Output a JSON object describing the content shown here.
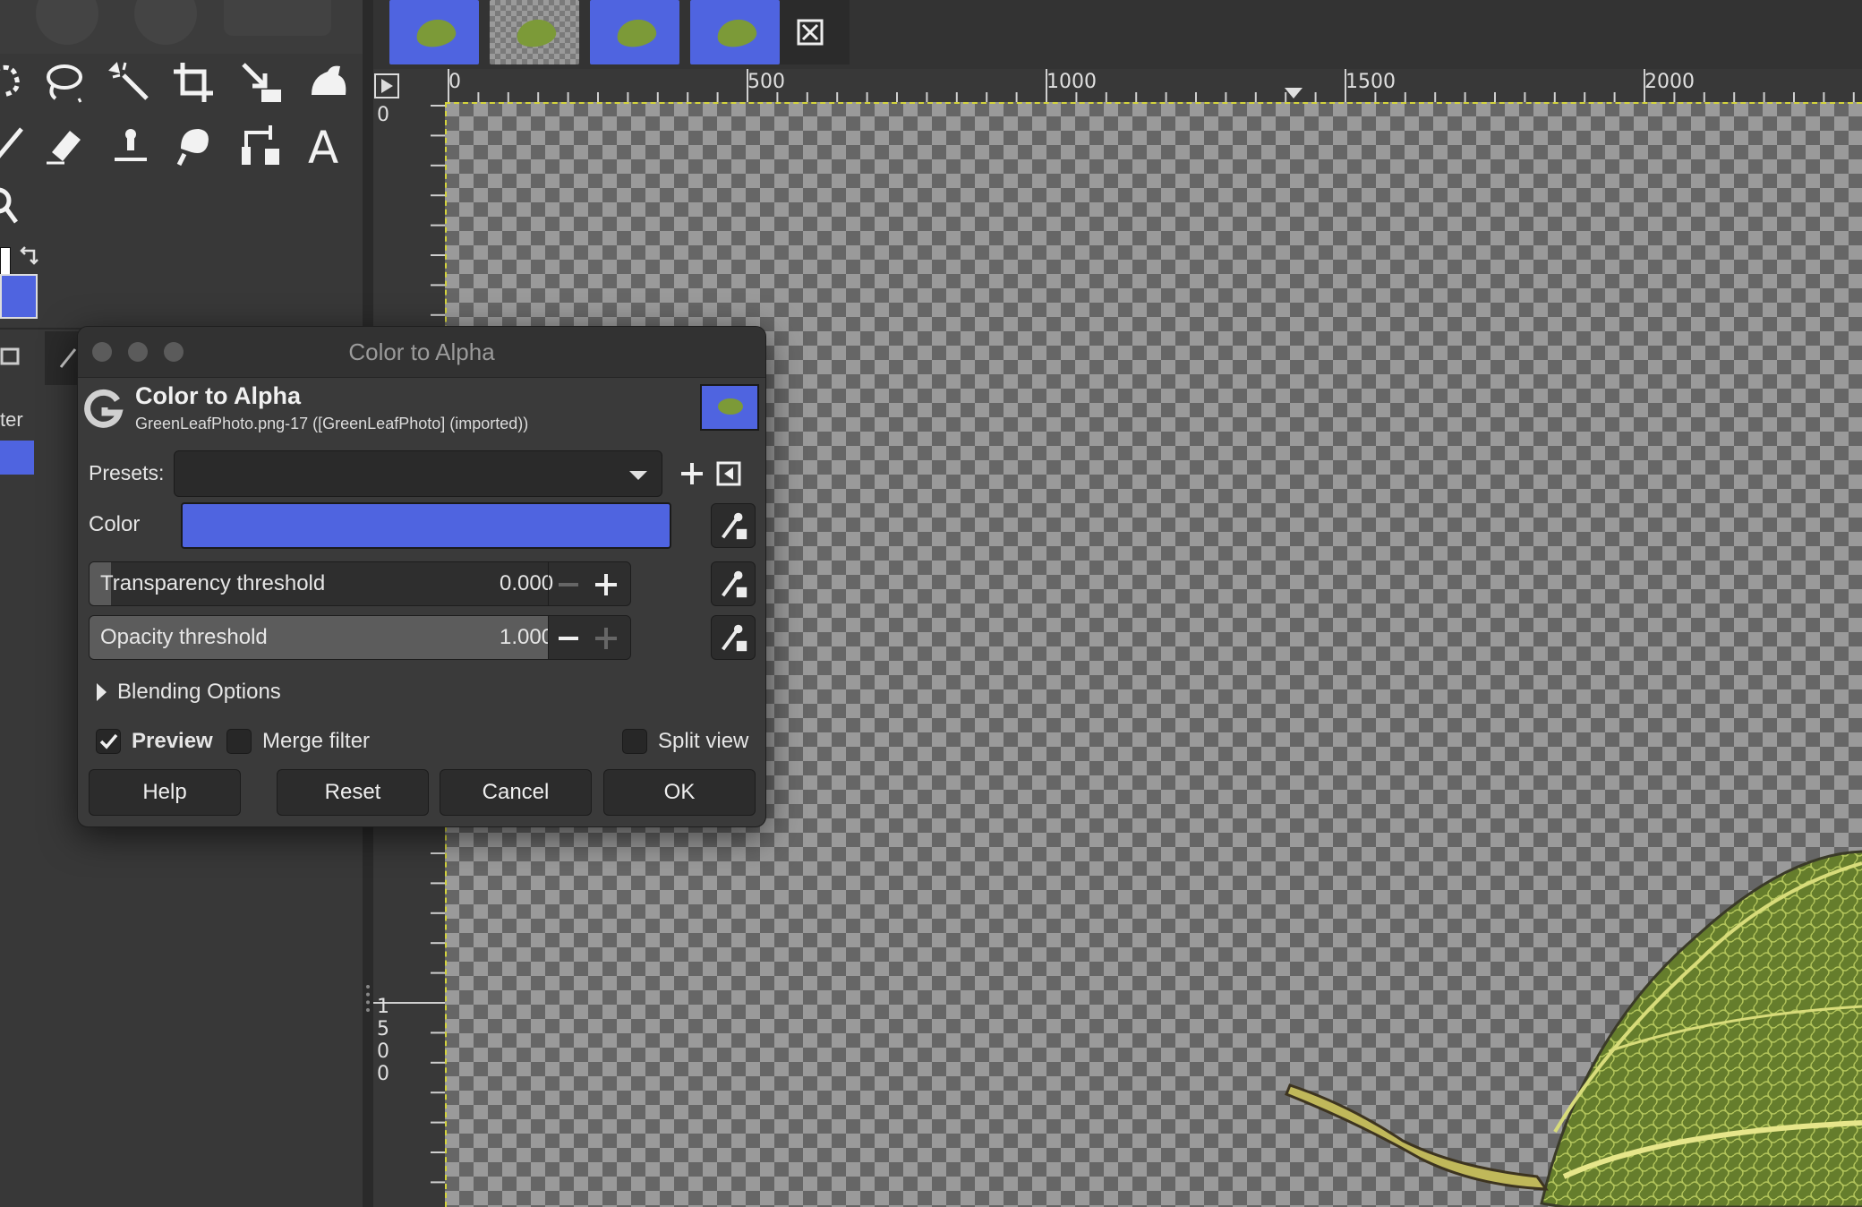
{
  "colors": {
    "accent_blue": "#4f64e0",
    "canvas_dark": "#666666",
    "canvas_light": "#9a9a9a",
    "dialog_bg": "#3a3a3a",
    "leaf_green": "#7c9a38"
  },
  "toolbox": {
    "tools": [
      "free-select-icon",
      "lasso-icon",
      "fuzzy-select-icon",
      "crop-icon",
      "scale-icon",
      "warp-icon",
      "pencil-icon",
      "eraser-icon",
      "clone-icon",
      "smudge-icon",
      "path-icon",
      "text-icon",
      "zoom-icon"
    ],
    "fg_color": "#ffffff",
    "bg_color": "#4f64e0",
    "panel_label": "ter"
  },
  "image_tabs": [
    {
      "type": "blue",
      "name": "image-tab-1"
    },
    {
      "type": "transparent",
      "name": "image-tab-2"
    },
    {
      "type": "blue",
      "name": "image-tab-3"
    },
    {
      "type": "blue",
      "name": "image-tab-4"
    }
  ],
  "ruler": {
    "h_labels": [
      "0",
      "500",
      "1000",
      "1500",
      "2000"
    ],
    "v_labels": [
      "0",
      "1500"
    ]
  },
  "dialog": {
    "window_title": "Color to Alpha",
    "header_title": "Color to Alpha",
    "header_subtitle": "GreenLeafPhoto.png-17 ([GreenLeafPhoto] (imported))",
    "presets_label": "Presets:",
    "presets_value": "",
    "color_label": "Color",
    "color_value": "#4f64e0",
    "transparency_label": "Transparency threshold",
    "transparency_value": "0.000",
    "transparency_fraction": 0.0,
    "opacity_label": "Opacity threshold",
    "opacity_value": "1.000",
    "opacity_fraction": 1.0,
    "blending_label": "Blending Options",
    "preview_label": "Preview",
    "preview_checked": true,
    "merge_label": "Merge filter",
    "merge_checked": false,
    "split_label": "Split view",
    "split_checked": false,
    "buttons": {
      "help": "Help",
      "reset": "Reset",
      "cancel": "Cancel",
      "ok": "OK"
    }
  }
}
